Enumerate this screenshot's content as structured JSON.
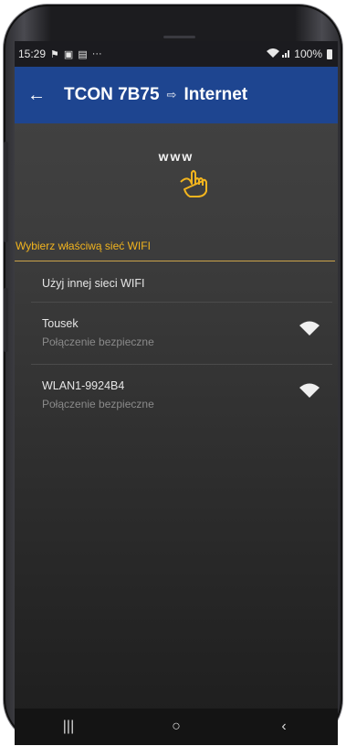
{
  "status_bar": {
    "time": "15:29",
    "left_icons": [
      "flag-icon",
      "image-icon",
      "linkedin-icon",
      "more-notifications-icon"
    ],
    "more": "···",
    "battery_percent": "100%"
  },
  "app_bar": {
    "back_icon": "arrow-left-icon",
    "device": "TCON 7B75",
    "arrow": "⇨",
    "target": "Internet",
    "color": "#1e4590"
  },
  "hint": {
    "label": "www",
    "icon": "pointing-hand-icon"
  },
  "wifi_section": {
    "title": "Wybierz właściwą sieć WIFI",
    "accent_color": "#f2b41e",
    "other_network": "Użyj innej sieci WIFI",
    "networks": [
      {
        "name": "Tousek",
        "security": "Połączenie bezpieczne",
        "icon": "wifi-icon"
      },
      {
        "name": "WLAN1-9924B4",
        "security": "Połączenie bezpieczne",
        "icon": "wifi-icon"
      }
    ]
  },
  "nav_bar": {
    "recent": "|||",
    "home": "○",
    "back": "‹"
  }
}
